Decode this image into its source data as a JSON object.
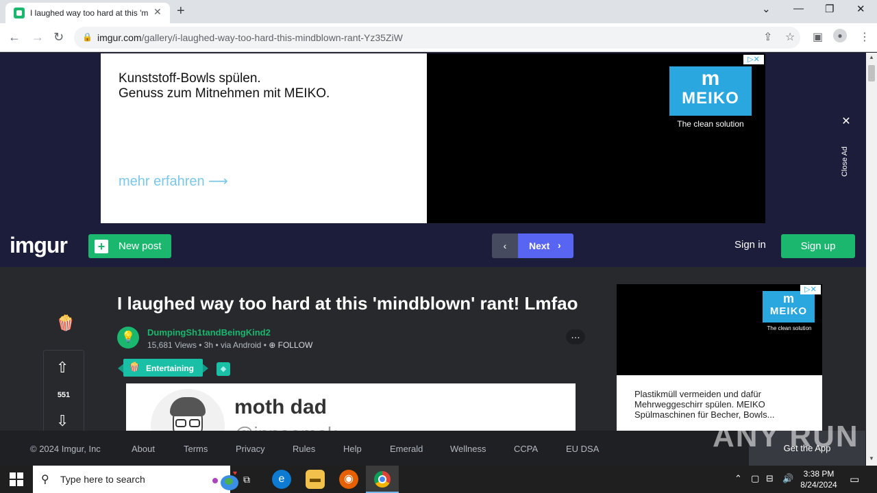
{
  "browser": {
    "tab_title": "I laughed way too hard at this 'mindblown' rant! Lmfao",
    "url_domain": "imgur.com",
    "url_path": "/gallery/i-laughed-way-too-hard-this-mindblown-rant-Yz35ZiW"
  },
  "banner_ad": {
    "line1": "Kunststoff-Bowls spülen.",
    "line2": "Genuss zum Mitnehmen mit MEIKO.",
    "cta": "mehr erfahren ⟶",
    "brand": "MEIKO",
    "brand_mark": "m",
    "tagline": "The clean solution",
    "close_ad": "Close Ad"
  },
  "nav": {
    "logo": "imgur",
    "new_post": "New post",
    "next": "Next",
    "sign_in": "Sign in",
    "sign_up": "Sign up"
  },
  "post": {
    "title": "I laughed way too hard at this 'mindblown' rant! Lmfao",
    "author": "DumpingSh1tandBeingKind2",
    "views": "15,681 Views",
    "age": "3h",
    "via": "via Android",
    "follow": "FOLLOW",
    "badge": "Entertaining",
    "votes": "551",
    "image_name": "moth dad",
    "image_handle": "@innaomak"
  },
  "side_ad": {
    "brand": "MEIKO",
    "brand_mark": "m",
    "tagline": "The clean solution",
    "text": "Plastikmüll vermeiden und dafür Mehrweggeschirr spülen. MEIKO Spülmaschinen für Becher, Bowls..."
  },
  "footer": {
    "copyright": "© 2024 Imgur, Inc",
    "links": [
      "About",
      "Terms",
      "Privacy",
      "Rules",
      "Help",
      "Emerald",
      "Wellness",
      "CCPA",
      "EU DSA"
    ],
    "get_app": "Get the App"
  },
  "watermark": "ANY RUN",
  "taskbar": {
    "search_placeholder": "Type here to search",
    "time": "3:38 PM",
    "date": "8/24/2024"
  },
  "colors": {
    "imgur_green": "#1bb76e",
    "next_blue": "#5865f2",
    "nav_bg": "#1b1d3b",
    "page_bg": "#27292d",
    "meiko_blue": "#2aa7df"
  }
}
